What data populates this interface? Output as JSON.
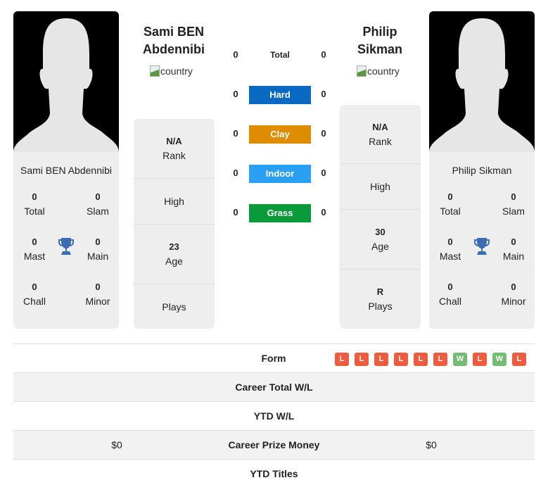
{
  "colors": {
    "hard": "#0a6ac2",
    "clay": "#de8c00",
    "indoor": "#2aa0f5",
    "grass": "#0a9a3a",
    "loss": "#ee5c40",
    "win": "#74bc74",
    "trophy": "#3b6db3"
  },
  "player1": {
    "name": "Sami BEN Abdennibi",
    "name_line1": "Sami BEN",
    "name_line2": "Abdennibi",
    "flag_alt": "country",
    "titles": {
      "total": "0",
      "slam": "0",
      "mast": "0",
      "main": "0",
      "chall": "0",
      "minor": "0"
    },
    "stats": {
      "rank_value": "N/A",
      "rank_label": "Rank",
      "high_label": "High",
      "age_value": "23",
      "age_label": "Age",
      "plays_label": "Plays"
    },
    "prize_money": "$0"
  },
  "player2": {
    "name": "Philip Sikman",
    "name_line1": "Philip",
    "name_line2": "Sikman",
    "flag_alt": "country",
    "titles": {
      "total": "0",
      "slam": "0",
      "mast": "0",
      "main": "0",
      "chall": "0",
      "minor": "0"
    },
    "stats": {
      "rank_value": "N/A",
      "rank_label": "Rank",
      "high_label": "High",
      "age_value": "30",
      "age_label": "Age",
      "plays_value": "R",
      "plays_label": "Plays"
    },
    "prize_money": "$0"
  },
  "title_labels": {
    "total": "Total",
    "slam": "Slam",
    "mast": "Mast",
    "main": "Main",
    "chall": "Chall",
    "minor": "Minor"
  },
  "h2h": [
    {
      "label": "Total",
      "p1": "0",
      "p2": "0"
    },
    {
      "label": "Hard",
      "p1": "0",
      "p2": "0"
    },
    {
      "label": "Clay",
      "p1": "0",
      "p2": "0"
    },
    {
      "label": "Indoor",
      "p1": "0",
      "p2": "0"
    },
    {
      "label": "Grass",
      "p1": "0",
      "p2": "0"
    }
  ],
  "bottom": {
    "form_label": "Form",
    "form": [
      "L",
      "L",
      "L",
      "L",
      "L",
      "L",
      "W",
      "L",
      "W",
      "L"
    ],
    "career_wl_label": "Career Total W/L",
    "ytd_wl_label": "YTD W/L",
    "prize_label": "Career Prize Money",
    "ytd_titles_label": "YTD Titles"
  }
}
